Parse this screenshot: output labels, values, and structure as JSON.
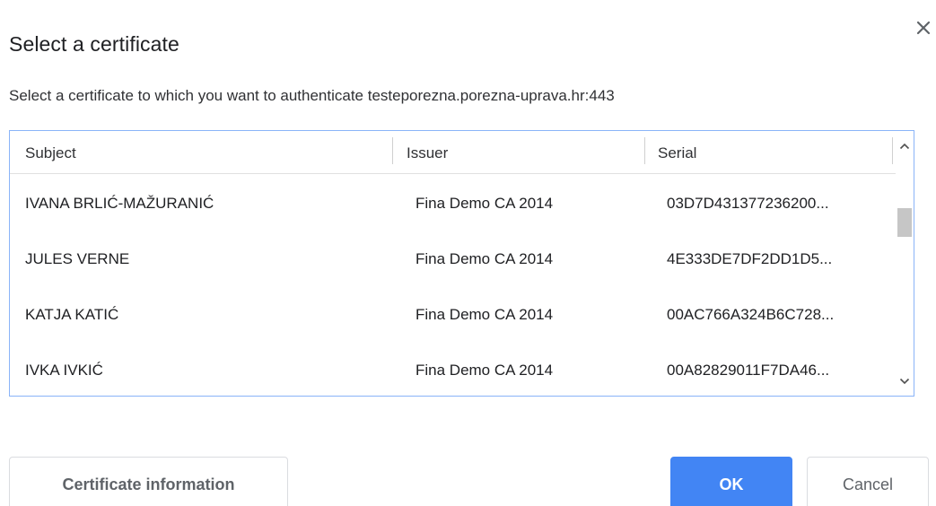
{
  "dialog": {
    "title": "Select a certificate",
    "subtitle": "Select a certificate to which you want to authenticate testeporezna.porezna-uprava.hr:443",
    "close_icon": "close-icon"
  },
  "table": {
    "columns": [
      "Subject",
      "Issuer",
      "Serial"
    ],
    "rows": [
      {
        "subject": "IVANA BRLIĆ-MAŽURANIĆ",
        "issuer": "Fina Demo CA 2014",
        "serial": "03D7D431377236200..."
      },
      {
        "subject": "JULES VERNE",
        "issuer": "Fina Demo CA 2014",
        "serial": "4E333DE7DF2DD1D5..."
      },
      {
        "subject": "KATJA KATIĆ",
        "issuer": "Fina Demo CA 2014",
        "serial": "00AC766A324B6C728..."
      },
      {
        "subject": "IVKA IVKIĆ",
        "issuer": "Fina Demo CA 2014",
        "serial": "00A82829011F7DA46..."
      }
    ]
  },
  "buttons": {
    "certificate_info": "Certificate information",
    "ok": "OK",
    "cancel": "Cancel"
  },
  "colors": {
    "accent": "#4285f4",
    "table_border": "#8ab4f8"
  }
}
